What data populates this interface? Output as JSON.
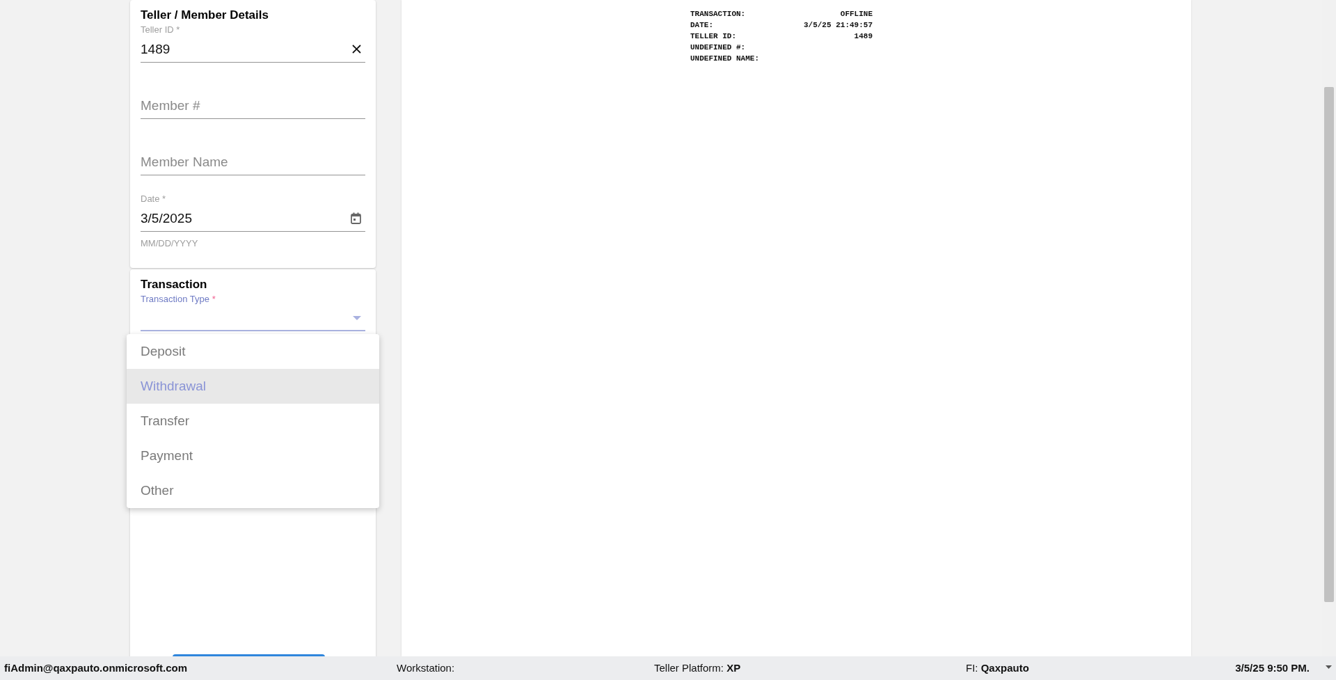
{
  "teller_member_details": {
    "title": "Teller / Member Details",
    "fields": [
      {
        "kind": "text",
        "label": "Teller ID *",
        "value": "1489",
        "clearable": true
      },
      {
        "kind": "text",
        "placeholder": "Member #"
      },
      {
        "kind": "text",
        "placeholder": "Member Name"
      },
      {
        "kind": "date",
        "label": "Date *",
        "value": "3/5/2025",
        "helper": "MM/DD/YYYY"
      }
    ]
  },
  "transaction": {
    "title": "Transaction",
    "fields": [
      {
        "kind": "select",
        "label": "Transaction Type",
        "required_mark": "*",
        "focused": true
      }
    ],
    "menu": {
      "items": [
        {
          "label": "Deposit",
          "selected": false
        },
        {
          "label": "Withdrawal",
          "selected": true
        },
        {
          "label": "Transfer",
          "selected": false
        },
        {
          "label": "Payment",
          "selected": false
        },
        {
          "label": "Other",
          "selected": false
        }
      ]
    }
  },
  "receipt": {
    "lines": [
      {
        "label": "TRANSACTION:",
        "value": "OFFLINE"
      },
      {
        "label": "DATE:",
        "value": "3/5/25 21:49:57"
      },
      {
        "label": "TELLER ID:",
        "value": "1489"
      },
      {
        "label": "UNDEFINED #:"
      },
      {
        "label": "UNDEFINED NAME:"
      }
    ]
  },
  "status_bar": {
    "user": "fiAdmin@qaxpauto.onmicrosoft.com",
    "workstation": "Workstation:",
    "platform": "Teller Platform: **XP**",
    "fi": "FI: **Qaxpauto**",
    "datetime": "3/5/25 9:50 PM."
  }
}
